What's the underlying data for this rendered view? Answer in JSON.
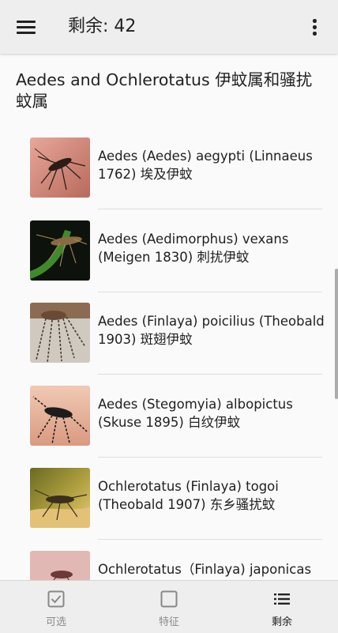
{
  "appbar": {
    "menu_icon": "hamburger-menu-icon",
    "title": "剩余: 42",
    "more_icon": "more-vert-icon"
  },
  "section": {
    "title": "Aedes and Ochlerotatus 伊蚊属和骚扰蚊属"
  },
  "items": [
    {
      "text": "Aedes (Aedes) aegypti (Linnaeus 1762) 埃及伊蚊",
      "thumb_icon": "mosquito-photo-icon"
    },
    {
      "text": "Aedes (Aedimorphus) vexans (Meigen 1830) 刺扰伊蚊",
      "thumb_icon": "mosquito-photo-icon"
    },
    {
      "text": "Aedes (Finlaya) poicilius (Theobald 1903) 斑翅伊蚊",
      "thumb_icon": "mosquito-photo-icon"
    },
    {
      "text": "Aedes (Stegomyia) albopictus (Skuse 1895) 白纹伊蚊",
      "thumb_icon": "mosquito-photo-icon"
    },
    {
      "text": "Ochlerotatus (Finlaya) togoi (Theobald 1907) 东乡骚扰蚊",
      "thumb_icon": "mosquito-photo-icon"
    },
    {
      "text": "Ochlerotatus（Finlaya) japonicas",
      "thumb_icon": "mosquito-photo-icon"
    }
  ],
  "bottom_nav": [
    {
      "label": "可选",
      "icon": "checkbox-checked-icon",
      "active": false
    },
    {
      "label": "特征",
      "icon": "checkbox-empty-icon",
      "active": false
    },
    {
      "label": "剩余",
      "icon": "list-icon",
      "active": true
    }
  ],
  "colors": {
    "appbar_bg": "#eeeeee",
    "background": "#fafafa",
    "text_primary": "#212121",
    "nav_inactive": "#8a8a8a"
  }
}
